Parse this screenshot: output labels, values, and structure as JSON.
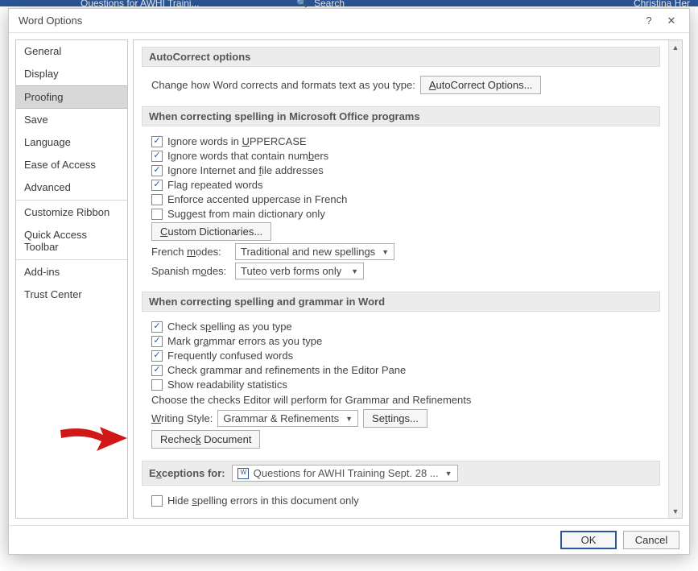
{
  "ribbon": {
    "tab_hint": "Questions for AWHI Traini...",
    "search_hint": "Search",
    "user_hint": "Christina Her"
  },
  "dialog": {
    "title": "Word Options",
    "help_icon": "?",
    "close_icon": "✕"
  },
  "nav": {
    "items": [
      "General",
      "Display",
      "Proofing",
      "Save",
      "Language",
      "Ease of Access",
      "Advanced",
      "Customize Ribbon",
      "Quick Access Toolbar",
      "Add-ins",
      "Trust Center"
    ],
    "selected": "Proofing"
  },
  "sections": {
    "autocorrect": {
      "title": "AutoCorrect options",
      "desc": "Change how Word corrects and formats text as you type:",
      "button": "AutoCorrect Options..."
    },
    "office_spell": {
      "title": "When correcting spelling in Microsoft Office programs",
      "opts": [
        {
          "label_pre": "Ignore words in ",
          "u": "U",
          "label_post": "PPERCASE",
          "checked": true
        },
        {
          "label_pre": "Ignore words that contain num",
          "u": "b",
          "label_post": "ers",
          "checked": true
        },
        {
          "label_pre": "Ignore Internet and ",
          "u": "f",
          "label_post": "ile addresses",
          "checked": true
        },
        {
          "label_pre": "Flag repeated words",
          "u": "",
          "label_post": "",
          "checked": true
        },
        {
          "label_pre": "Enforce accented uppercase in French",
          "u": "",
          "label_post": "",
          "checked": false
        },
        {
          "label_pre": "Suggest from main dictionary only",
          "u": "",
          "label_post": "",
          "checked": false
        }
      ],
      "custom_dict_btn": "Custom Dictionaries...",
      "french_label": "French modes:",
      "french_value": "Traditional and new spellings",
      "spanish_label": "Spanish modes:",
      "spanish_value": "Tuteo verb forms only"
    },
    "word_spell": {
      "title": "When correcting spelling and grammar in Word",
      "opts": [
        {
          "label": "Check spelling as you type",
          "u": "p",
          "checked": true
        },
        {
          "label": "Mark grammar errors as you type",
          "u": "a",
          "checked": true
        },
        {
          "label": "Frequently confused words",
          "u": "",
          "checked": true
        },
        {
          "label": "Check grammar and refinements in the Editor Pane",
          "u": "",
          "checked": true
        },
        {
          "label": "Show readability statistics",
          "u": "",
          "checked": false
        }
      ],
      "choose_note": "Choose the checks Editor will perform for Grammar and Refinements",
      "writing_style_label": "Writing Style:",
      "writing_style_value": "Grammar & Refinements",
      "settings_btn": "Settings...",
      "recheck_btn": "Recheck Document"
    },
    "exceptions": {
      "title": "Exceptions for:",
      "doc_value": "Questions for AWHI Training Sept. 28 ...",
      "opts": [
        {
          "label": "Hide spelling errors in this document only",
          "u": "s",
          "checked": false
        }
      ]
    }
  },
  "footer": {
    "ok": "OK",
    "cancel": "Cancel"
  }
}
